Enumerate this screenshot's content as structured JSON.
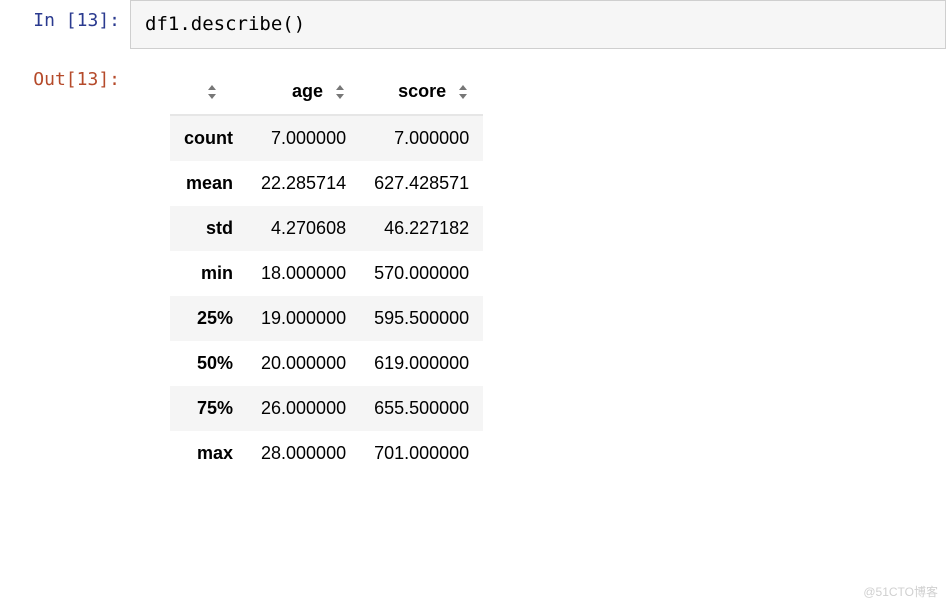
{
  "input_prompt": "In [13]:",
  "output_prompt": "Out[13]:",
  "code": {
    "object": "df1",
    "dot": ".",
    "method": "describe",
    "open": "(",
    "close": ")"
  },
  "chart_data": {
    "type": "table",
    "columns": [
      "age",
      "score"
    ],
    "index": [
      "count",
      "mean",
      "std",
      "min",
      "25%",
      "50%",
      "75%",
      "max"
    ],
    "rows": [
      {
        "label": "count",
        "age": "7.000000",
        "score": "7.000000"
      },
      {
        "label": "mean",
        "age": "22.285714",
        "score": "627.428571"
      },
      {
        "label": "std",
        "age": "4.270608",
        "score": "46.227182"
      },
      {
        "label": "min",
        "age": "18.000000",
        "score": "570.000000"
      },
      {
        "label": "25%",
        "age": "19.000000",
        "score": "595.500000"
      },
      {
        "label": "50%",
        "age": "20.000000",
        "score": "619.000000"
      },
      {
        "label": "75%",
        "age": "26.000000",
        "score": "655.500000"
      },
      {
        "label": "max",
        "age": "28.000000",
        "score": "701.000000"
      }
    ]
  },
  "icons": {
    "sort": "sort-icon"
  },
  "watermark": "@51CTO博客"
}
